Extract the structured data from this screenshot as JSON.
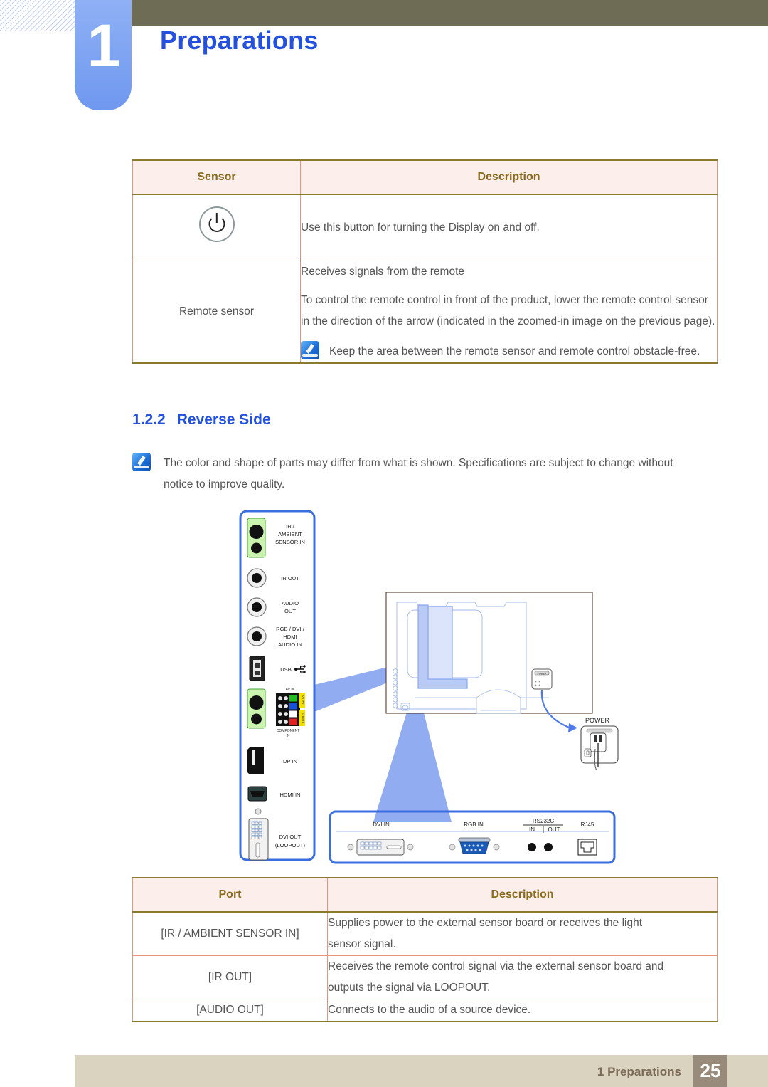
{
  "header": {
    "chapter_number": "1",
    "chapter_title": "Preparations"
  },
  "sensor_table": {
    "headers": [
      "Sensor",
      "Description"
    ],
    "rows": [
      {
        "icon": "power-button-icon",
        "label": "",
        "description_lines": [
          "Use this button for turning the Display on and off."
        ],
        "note": null
      },
      {
        "icon": null,
        "label": "Remote sensor",
        "description_lines": [
          "Receives signals from the remote",
          "To control the remote control in front of the product, lower the remote control sensor in the direction of the arrow (indicated in the zoomed-in image on the previous page)."
        ],
        "note": "Keep the area between the remote sensor and remote control obstacle-free."
      }
    ]
  },
  "section": {
    "number": "1.2.2",
    "title": "Reverse Side",
    "note": "The color and shape of parts may differ from what is shown. Specifications are subject to change without notice to improve quality."
  },
  "diagram": {
    "side_panel_ports": [
      {
        "id": "ir-ambient-sensor-in",
        "label": "IR /\nAMBIENT\nSENSOR IN",
        "type": "dual-jack-green"
      },
      {
        "id": "ir-out",
        "label": "IR OUT",
        "type": "jack"
      },
      {
        "id": "audio-out",
        "label": "AUDIO\nOUT",
        "type": "jack"
      },
      {
        "id": "rgb-dvi-hdmi-audio-in",
        "label": "RGB / DVI /\nHDMI\nAUDIO IN",
        "type": "jack"
      },
      {
        "id": "usb",
        "label": "USB",
        "type": "usb"
      },
      {
        "id": "av-in-component-in",
        "label": "AV IN",
        "sublabel": "COMPONENT\nIN",
        "side_labels": [
          "VIDEO",
          "AUDIO"
        ],
        "type": "component"
      },
      {
        "id": "dp-in",
        "label": "DP IN",
        "type": "displayport"
      },
      {
        "id": "hdmi-in",
        "label": "HDMI IN",
        "type": "hdmi"
      },
      {
        "id": "dvi-out-loopout",
        "label": "DVI OUT\n(LOOPOUT)",
        "type": "dvi"
      }
    ],
    "bottom_panel_ports": [
      {
        "id": "dvi-in",
        "label": "DVI IN"
      },
      {
        "id": "rgb-in",
        "label": "RGB IN"
      },
      {
        "id": "rs232c",
        "label": "RS232C",
        "sub": [
          "IN",
          "OUT"
        ]
      },
      {
        "id": "rj45",
        "label": "RJ45"
      }
    ],
    "power_callout": "POWER",
    "monitor_power_badge": "POWER"
  },
  "port_table": {
    "headers": [
      "Port",
      "Description"
    ],
    "rows": [
      {
        "port": "[IR / AMBIENT SENSOR IN]",
        "description": "Supplies power to the external sensor board or receives the light sensor signal."
      },
      {
        "port": "[IR OUT]",
        "description": "Receives the remote control signal via the external sensor board and outputs the signal via LOOPOUT."
      },
      {
        "port": "[AUDIO OUT]",
        "description": "Connects to the audio of a source device."
      }
    ]
  },
  "footer": {
    "text": "1 Preparations",
    "page_number": "25"
  },
  "colors": {
    "accent_blue": "#2450e0",
    "olive_bar": "#6f6c55",
    "table_header_bg": "#fbeeeb",
    "table_header_text": "#8a6a1e",
    "table_border": "#e8937c",
    "footer_bar": "#d9d3c0",
    "footer_page_bg": "#988b7c",
    "diagram_outline": "#3a6ee0"
  }
}
